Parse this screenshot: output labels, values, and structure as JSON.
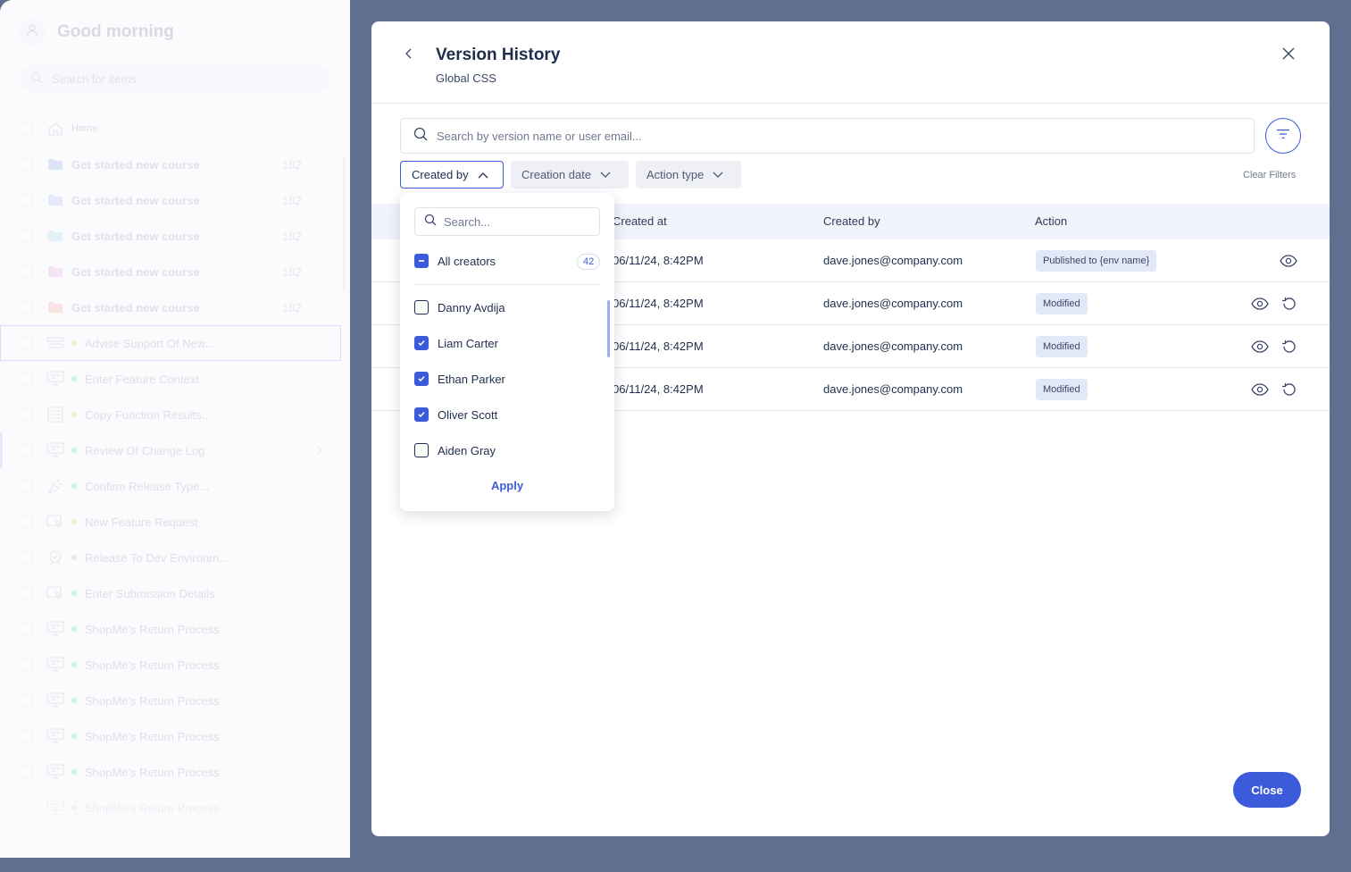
{
  "sidebar": {
    "greeting": "Good morning",
    "search_placeholder": "Search for items",
    "home_label": "Home",
    "folders": [
      {
        "label": "Get started new course",
        "count": "182",
        "color": "#b7c4ee"
      },
      {
        "label": "Get started new course",
        "count": "182",
        "color": "#c3d0f3"
      },
      {
        "label": "Get started new course",
        "count": "182",
        "color": "#bfe2f0"
      },
      {
        "label": "Get started new course",
        "count": "182",
        "color": "#e8c4ec"
      },
      {
        "label": "Get started new course",
        "count": "182",
        "color": "#f3c1c1"
      }
    ],
    "items": [
      {
        "label": "Advise Support Of New...",
        "dot": "#f5d98a",
        "icon": "list-flow-icon"
      },
      {
        "label": "Enter Feature Context",
        "dot": "#9ad8b6",
        "icon": "presentation-icon"
      },
      {
        "label": "Copy Function Results...",
        "dot": "#f5d98a",
        "icon": "checklist-icon"
      },
      {
        "label": "Review Of Change Log",
        "dot": "#9ad8b6",
        "icon": "presentation-icon"
      },
      {
        "label": "Confirm Release Type...",
        "dot": "#9ad8b6",
        "icon": "launch-icon"
      },
      {
        "label": "New Feature Request",
        "dot": "#f5d98a",
        "icon": "cursor-window-icon"
      },
      {
        "label": "Release To Dev Environm...",
        "dot": "#c8cdd8",
        "icon": "badge-icon"
      },
      {
        "label": "Enter Submission Details",
        "dot": "#9ad8b6",
        "icon": "cursor-window-icon"
      },
      {
        "label": "ShopMe's Return Process",
        "dot": "#9ad8b6",
        "icon": "presentation-icon"
      },
      {
        "label": "ShopMe's Return Process",
        "dot": "#9ad8b6",
        "icon": "presentation-icon"
      },
      {
        "label": "ShopMe's Return Process",
        "dot": "#9ad8b6",
        "icon": "presentation-icon"
      },
      {
        "label": "ShopMe's Return Process",
        "dot": "#9ad8b6",
        "icon": "presentation-icon"
      },
      {
        "label": "ShopMe's Return Process",
        "dot": "#9ad8b6",
        "icon": "presentation-icon"
      },
      {
        "label": "ShopMe's Return Process",
        "dot": "#c8cdd8",
        "icon": "presentation-icon"
      }
    ]
  },
  "modal": {
    "title": "Version History",
    "subtitle": "Global CSS",
    "search_placeholder": "Search by version name or user email...",
    "filters": {
      "created_by": "Created by",
      "creation_date": "Creation date",
      "action_type": "Action type",
      "clear": "Clear Filters"
    },
    "columns": {
      "created_at": "Created at",
      "created_by": "Created by",
      "action": "Action"
    },
    "rows": [
      {
        "created_at": "06/11/24, 8:42PM",
        "created_by": "dave.jones@company.com",
        "action": "Published to {env name}",
        "restore": false
      },
      {
        "created_at": "06/11/24, 8:42PM",
        "created_by": "dave.jones@company.com",
        "action": "Modified",
        "restore": true
      },
      {
        "created_at": "06/11/24, 8:42PM",
        "created_by": "dave.jones@company.com",
        "action": "Modified",
        "restore": true
      },
      {
        "created_at": "06/11/24, 8:42PM",
        "created_by": "dave.jones@company.com",
        "action": "Modified",
        "restore": true
      }
    ],
    "close_label": "Close"
  },
  "dropdown": {
    "search_placeholder": "Search...",
    "all_label": "All creators",
    "all_count": "42",
    "creators": [
      {
        "name": "Danny Avdija",
        "checked": false
      },
      {
        "name": "Liam Carter",
        "checked": true
      },
      {
        "name": "Ethan Parker",
        "checked": true
      },
      {
        "name": "Oliver Scott",
        "checked": true
      },
      {
        "name": "Aiden Gray",
        "checked": false
      }
    ],
    "apply_label": "Apply"
  },
  "colors": {
    "accent": "#3b5bdb",
    "backdrop": "#5f6f8f",
    "badge_bg": "#e3e8f8"
  }
}
